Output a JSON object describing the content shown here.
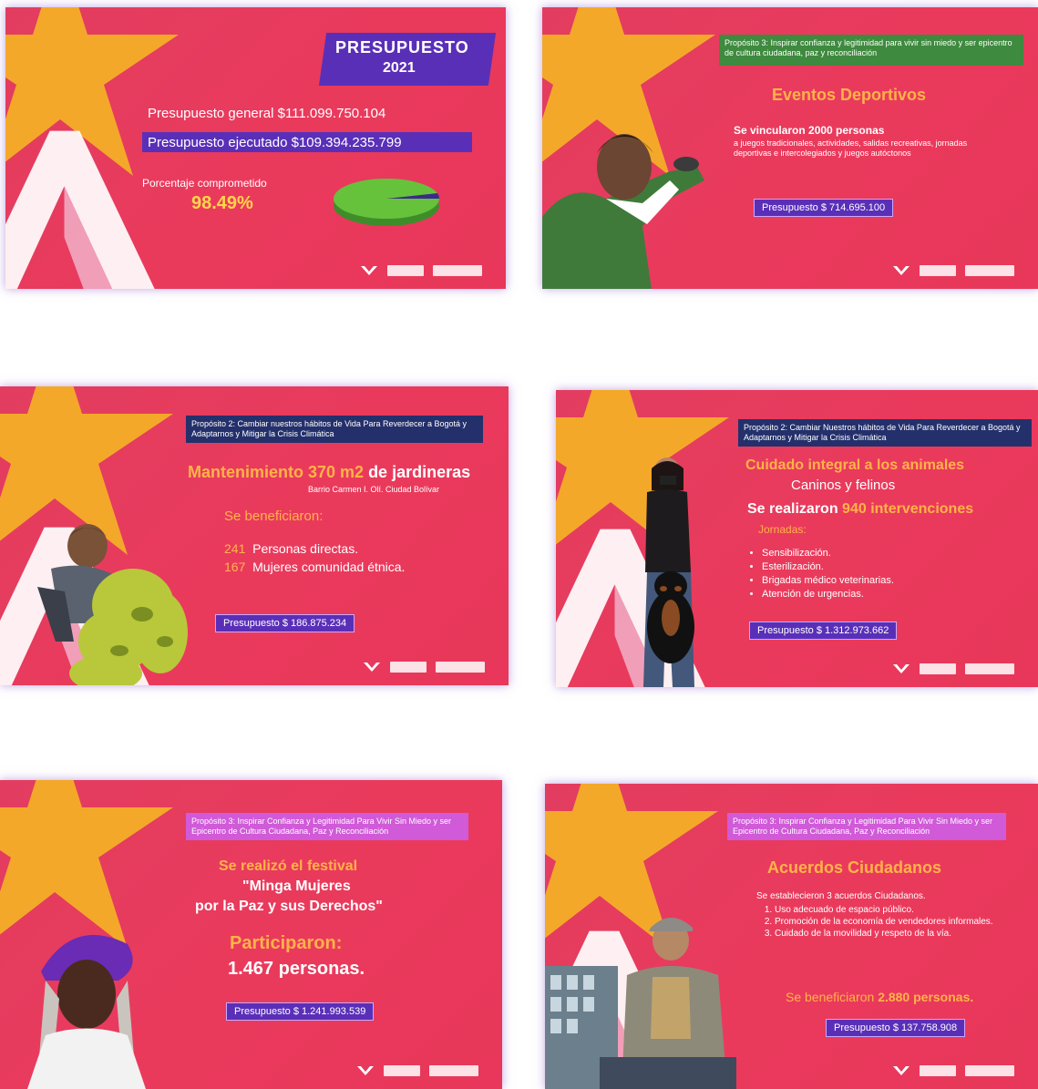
{
  "s1": {
    "title_line1": "PRESUPUESTO",
    "title_line2": "2021",
    "general": "Presupuesto general $111.099.750.104",
    "ejecutado": "Presupuesto ejecutado $109.394.235.799",
    "pct_label": "Porcentaje comprometido",
    "pct_value": "98.49%"
  },
  "s2": {
    "project": "Propósito 3: Inspirar confianza y legitimidad para vivir sin miedo y ser epicentro de cultura ciudadana, paz y reconciliación",
    "title": "Eventos Deportivos",
    "body_bold": "Se vincularon 2000 personas",
    "body": "a juegos tradicionales, actividades, salidas recreativas, jornadas deportivas e intercolegiados y juegos autóctonos",
    "budget": "Presupuesto $ 714.695.100"
  },
  "s3": {
    "project": "Propósito 2: Cambiar nuestros hábitos de Vida Para Reverdecer a Bogotá y Adaptarnos y Mitigar la Crisis Climática",
    "title_a": "Mantenimiento 370 m2",
    "title_b": " de jardineras",
    "subtitle": "Barrio Carmen I. Olí. Ciudad Bolívar",
    "benef": "Se beneficiaron:",
    "n1": "241",
    "t1": "Personas directas.",
    "n2": "167",
    "t2": "Mujeres comunidad étnica.",
    "budget": "Presupuesto $ 186.875.234"
  },
  "s4": {
    "project": "Propósito 2: Cambiar Nuestros hábitos de Vida Para Reverdecer a Bogotá y Adaptarnos y Mitigar la Crisis Climática",
    "title": "Cuidado integral a los animales",
    "subtitle": "Caninos y felinos",
    "interv_a": "Se realizaron ",
    "interv_b": "940 intervenciones",
    "jornadas": "Jornadas:",
    "items": [
      "Sensibilización.",
      "Esterilización.",
      "Brigadas médico veterinarias.",
      "Atención de urgencias."
    ],
    "budget": "Presupuesto $ 1.312.973.662"
  },
  "s5": {
    "project": "Propósito 3: Inspirar Confianza y Legitimidad Para Vivir Sin Miedo y ser Epicentro de Cultura Ciudadana, Paz y Reconciliación",
    "line1": "Se realizó el festival",
    "line2": "\"Minga Mujeres",
    "line3": "por la Paz y sus Derechos\"",
    "part": "Participaron:",
    "count": "1.467 personas.",
    "budget": "Presupuesto $ 1.241.993.539"
  },
  "s6": {
    "project": "Propósito 3: Inspirar Confianza y Legitimidad Para Vivir Sin Miedo y ser Epicentro de Cultura Ciudadana, Paz y Reconciliación",
    "title": "Acuerdos Ciudadanos",
    "intro": "Se establecieron 3 acuerdos Ciudadanos.",
    "items": [
      "Uso adecuado de espacio público.",
      "Promoción de la economía de vendedores informales.",
      "Cuidado de la movilidad y respeto de la vía."
    ],
    "benef_a": "Se beneficiaron ",
    "benef_b": "2.880 personas.",
    "budget": "Presupuesto $ 137.758.908"
  },
  "colors": {
    "slide_bg": "#e8385c",
    "star": "#f4a82a",
    "purple": "#5a2fb8",
    "green_bar": "#3e8a3e",
    "navy_bar": "#24306b",
    "pink_bar": "#d05ad8",
    "yellow_text": "#ffd54a"
  }
}
